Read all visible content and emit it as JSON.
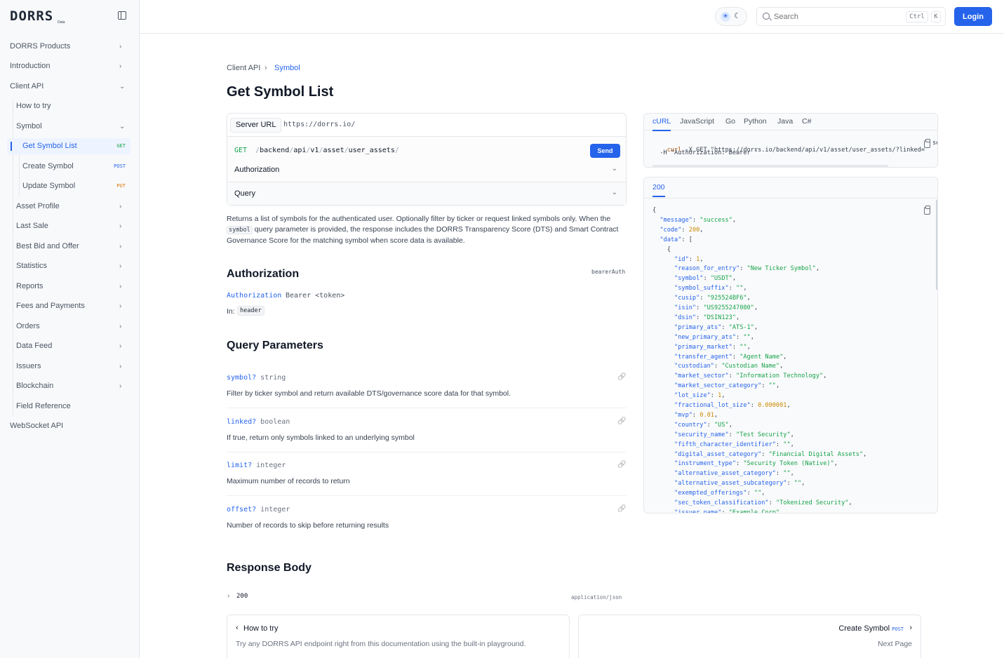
{
  "brand": {
    "logo": "DORRS",
    "logo_sub": "Data"
  },
  "sidebar": {
    "items": [
      {
        "label": "DORRS Products",
        "chevron": "›"
      },
      {
        "label": "Introduction",
        "chevron": "›"
      },
      {
        "label": "Client API",
        "chevron": "⌄"
      },
      {
        "label": "How to try"
      },
      {
        "label": "Symbol",
        "chevron": "⌄"
      },
      {
        "label": "Get Symbol List",
        "method": "GET"
      },
      {
        "label": "Create Symbol",
        "method": "POST"
      },
      {
        "label": "Update Symbol",
        "method": "PUT"
      },
      {
        "label": "Asset Profile",
        "chevron": "›"
      },
      {
        "label": "Last Sale",
        "chevron": "›"
      },
      {
        "label": "Best Bid and Offer",
        "chevron": "›"
      },
      {
        "label": "Statistics",
        "chevron": "›"
      },
      {
        "label": "Reports",
        "chevron": "›"
      },
      {
        "label": "Fees and Payments",
        "chevron": "›"
      },
      {
        "label": "Orders",
        "chevron": "›"
      },
      {
        "label": "Data Feed",
        "chevron": "›"
      },
      {
        "label": "Issuers",
        "chevron": "›"
      },
      {
        "label": "Blockchain",
        "chevron": "›"
      },
      {
        "label": "Field Reference"
      },
      {
        "label": "WebSocket API"
      }
    ]
  },
  "topbar": {
    "sun": "☀",
    "moon": "☾",
    "search_placeholder": "Search",
    "kbd_ctrl": "Ctrl",
    "kbd_k": "K",
    "login": "Login"
  },
  "breadcrumb": {
    "parent": "Client API",
    "sep": "›",
    "current": "Symbol"
  },
  "page_title": "Get Symbol List",
  "playground": {
    "server_label": "Server URL",
    "server_url": "https://dorrs.io/",
    "method": "GET",
    "path_segments": [
      "backend",
      "api",
      "v1",
      "asset",
      "user_assets"
    ],
    "send": "Send",
    "authorization": "Authorization",
    "query": "Query",
    "chevron": "⌄"
  },
  "description": {
    "part1": "Returns a list of symbols for the authenticated user. Optionally filter by ticker or request linked symbols only. When the",
    "code": "symbol",
    "part2": "query parameter is provided, the response includes the DORRS Transparency Score (DTS) and Smart Contract Governance Score for the matching symbol when score data is available."
  },
  "auth_section": {
    "title": "Authorization",
    "scheme": "bearerAuth",
    "param": "Authorization",
    "value": "Bearer <token>",
    "in_label": "In:",
    "in_value": "header"
  },
  "query_section": {
    "title": "Query Parameters",
    "params": [
      {
        "name": "symbol?",
        "type": "string",
        "desc": "Filter by ticker symbol and return available DTS/governance score data for that symbol."
      },
      {
        "name": "linked?",
        "type": "boolean",
        "desc": "If true, return only symbols linked to an underlying symbol"
      },
      {
        "name": "limit?",
        "type": "integer",
        "desc": "Maximum number of records to return"
      },
      {
        "name": "offset?",
        "type": "integer",
        "desc": "Number of records to skip before returning results"
      }
    ]
  },
  "response_section": {
    "title": "Response Body",
    "code": "200",
    "content_type": "application/json"
  },
  "pager": {
    "prev_title": "How to try",
    "prev_desc": "Try any DORRS API endpoint right from this documentation using the built-in playground.",
    "next_title": "Create Symbol",
    "next_method": "POST",
    "next_desc": "Next Page"
  },
  "code_sample": {
    "tabs": [
      "cURL",
      "JavaScript",
      "Go",
      "Python",
      "Java",
      "C#"
    ],
    "line1": "curl -X GET \"https://dorrs.io/backend/api/v1/asset/user_assets/?linked=",
    "line1_tail": "se",
    "line2": "  -H \"Authorization: Bearer \""
  },
  "response_sample": {
    "tab": "200",
    "json": [
      [
        "{",
        "",
        ""
      ],
      [
        "  ",
        "message",
        "success"
      ],
      [
        "  ",
        "code",
        "200"
      ],
      [
        "  ",
        "data",
        "["
      ],
      [
        "    {",
        "",
        ""
      ],
      [
        "      ",
        "id",
        "1"
      ],
      [
        "      ",
        "reason_for_entry",
        "New Ticker Symbol"
      ],
      [
        "      ",
        "symbol",
        "USDT"
      ],
      [
        "      ",
        "symbol_suffix",
        ""
      ],
      [
        "      ",
        "cusip",
        "925524BF6"
      ],
      [
        "      ",
        "isin",
        "US9255247080"
      ],
      [
        "      ",
        "dsin",
        "DSIN123"
      ],
      [
        "      ",
        "primary_ats",
        "ATS-1"
      ],
      [
        "      ",
        "new_primary_ats",
        ""
      ],
      [
        "      ",
        "primary_market",
        ""
      ],
      [
        "      ",
        "transfer_agent",
        "Agent Name"
      ],
      [
        "      ",
        "custodian",
        "Custodian Name"
      ],
      [
        "      ",
        "market_sector",
        "Information Technology"
      ],
      [
        "      ",
        "market_sector_category",
        ""
      ],
      [
        "      ",
        "lot_size",
        "1"
      ],
      [
        "      ",
        "fractional_lot_size",
        "0.000001"
      ],
      [
        "      ",
        "mvp",
        "0.01"
      ],
      [
        "      ",
        "country",
        "US"
      ],
      [
        "      ",
        "security_name",
        "Test Security"
      ],
      [
        "      ",
        "fifth_character_identifier",
        ""
      ],
      [
        "      ",
        "digital_asset_category",
        "Financial Digital Assets"
      ],
      [
        "      ",
        "instrument_type",
        "Security Token (Native)"
      ],
      [
        "      ",
        "alternative_asset_category",
        ""
      ],
      [
        "      ",
        "alternative_asset_subcategory",
        ""
      ],
      [
        "      ",
        "exempted_offerings",
        ""
      ],
      [
        "      ",
        "sec_token_classification",
        "Tokenized Security"
      ],
      [
        "      ",
        "issuer_name",
        "Example Corp"
      ]
    ]
  },
  "colors": {
    "accent": "#2563eb",
    "get": "#16a34a",
    "post": "#2563eb",
    "put": "#d97706"
  }
}
